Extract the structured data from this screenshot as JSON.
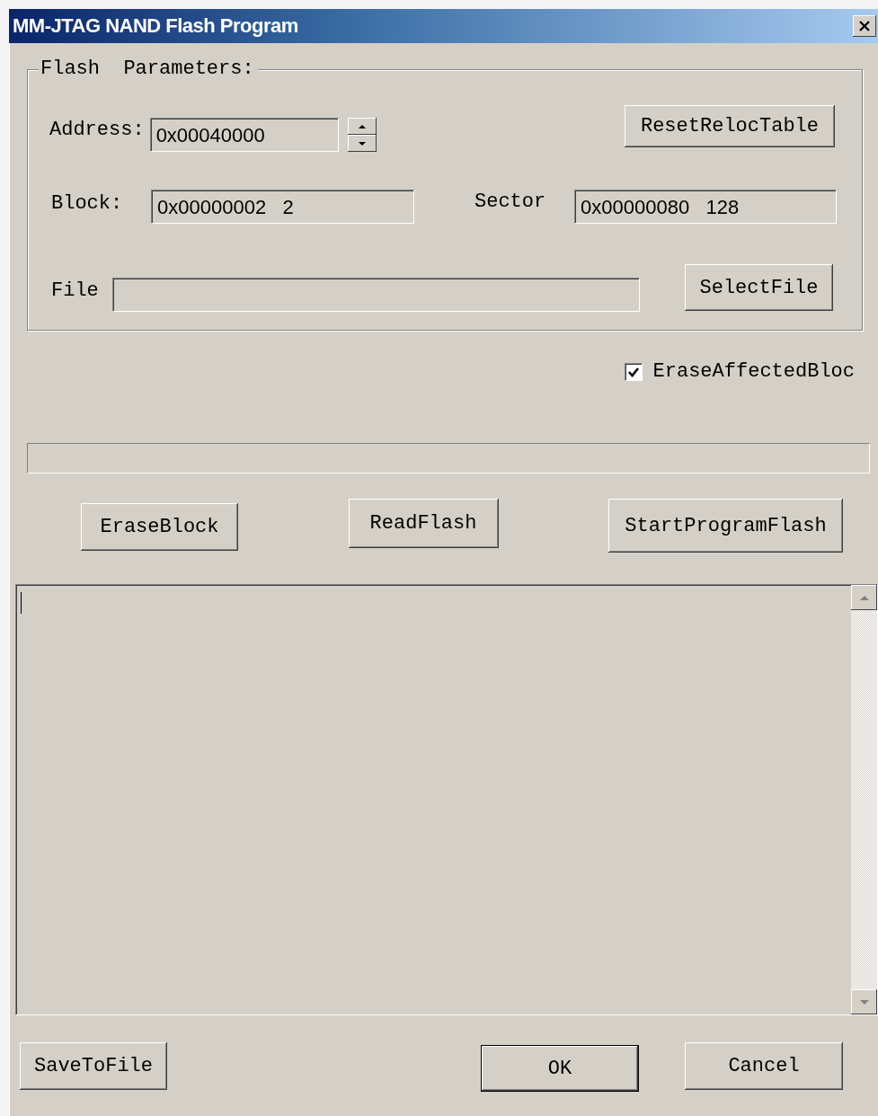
{
  "window": {
    "title": "MM-JTAG NAND Flash Program"
  },
  "group": {
    "legend": "Flash  Parameters:"
  },
  "address": {
    "label": "Address:",
    "value": "0x00040000"
  },
  "reset_button": "ResetRelocTable",
  "block": {
    "label": "Block:",
    "value": "0x00000002   2"
  },
  "sector": {
    "label": "Sector",
    "value": "0x00000080   128"
  },
  "file": {
    "label": "File"
  },
  "select_button": "SelectFile",
  "erase_affected": {
    "label": "EraseAffectedBloc",
    "checked": true
  },
  "progress": {
    "level": 0
  },
  "actions": [
    "EraseBlock",
    "ReadFlash",
    "StartProgramFlash"
  ],
  "bottom_buttons": [
    {
      "label": "SaveToFile",
      "default": false
    },
    {
      "label": "OK",
      "default": true
    },
    {
      "label": "Cancel",
      "default": false
    }
  ]
}
